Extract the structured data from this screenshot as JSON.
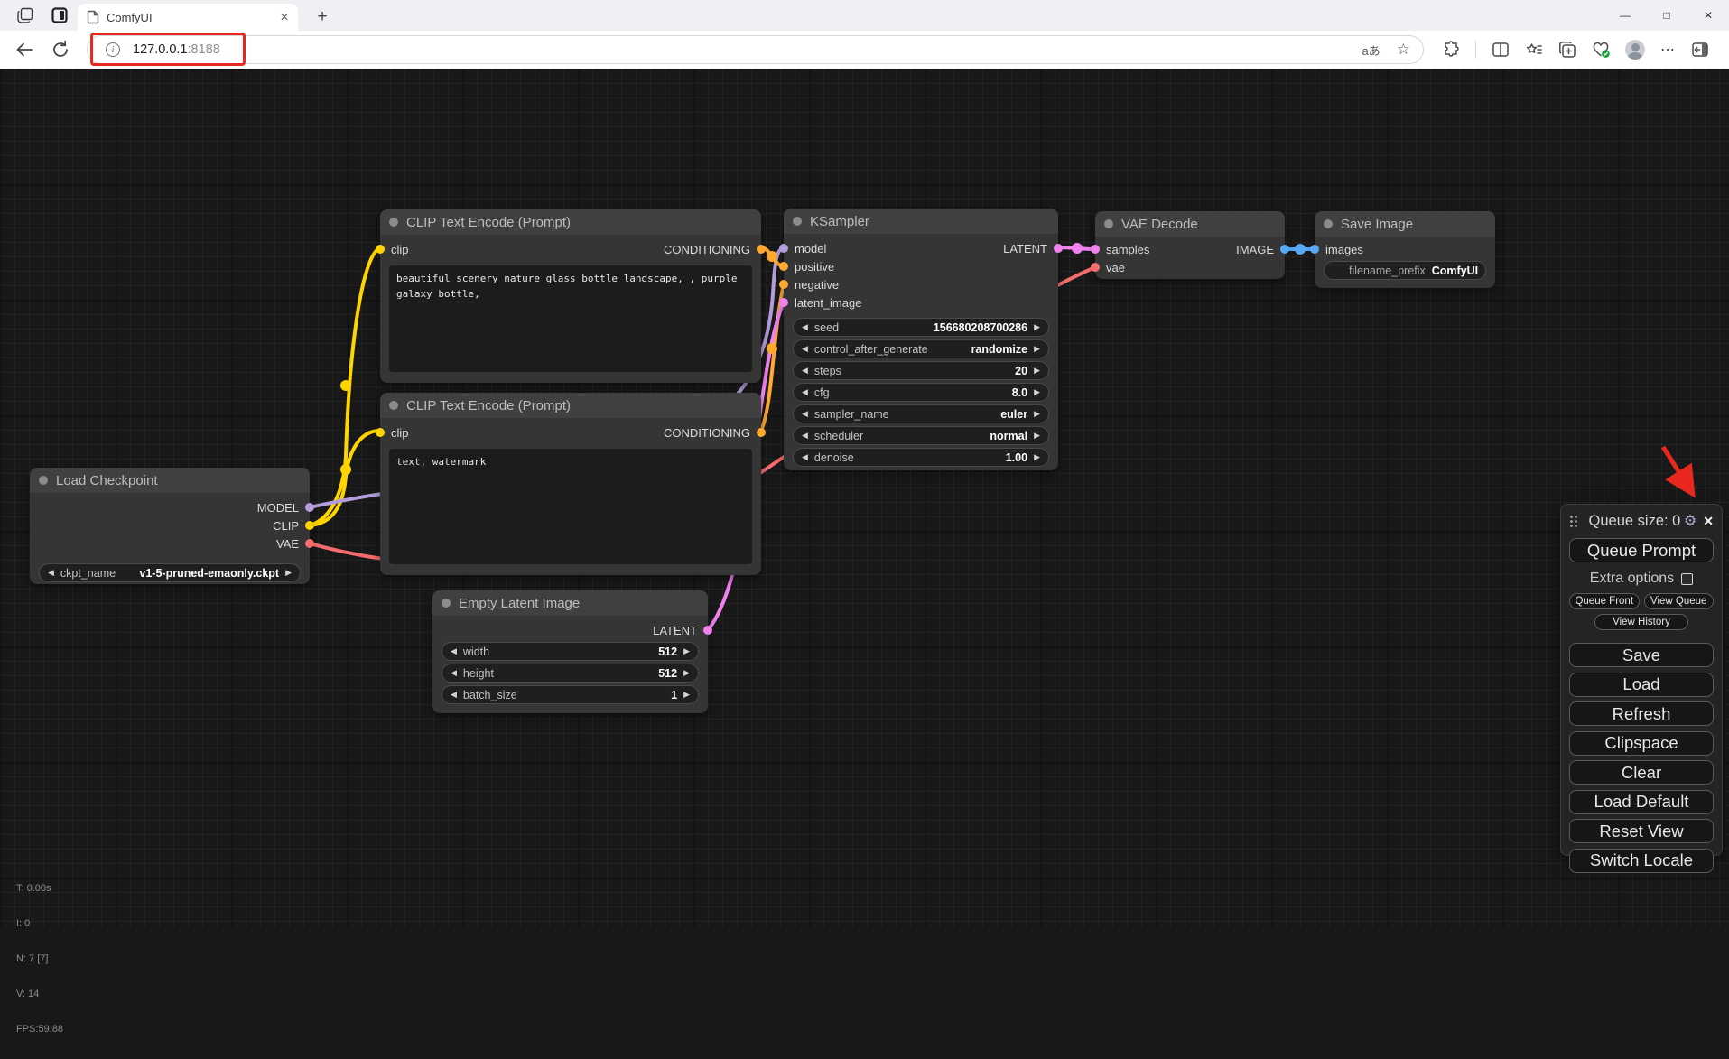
{
  "browser": {
    "tab_title": "ComfyUI",
    "url_host": "127.0.0.1",
    "url_port": ":8188",
    "translate_glyph": "aあ",
    "star_glyph": "☆",
    "info_glyph": "i",
    "close_glyph": "✕",
    "plus_glyph": "+",
    "minimize_glyph": "—",
    "maximize_glyph": "□",
    "more_glyph": "⋯"
  },
  "annotation_color": "#e8281e",
  "port_colors": {
    "MODEL": "#b39ddb",
    "CLIP": "#ffd500",
    "VAE": "#f56c6c",
    "CONDITIONING": "#ffa931",
    "LATENT": "#f183f1",
    "IMAGE": "#58a8f5"
  },
  "nodes": {
    "load_checkpoint": {
      "title": "Load Checkpoint",
      "outputs": {
        "model": "MODEL",
        "clip": "CLIP",
        "vae": "VAE"
      },
      "widgets": [
        {
          "label": "ckpt_name",
          "value": "v1-5-pruned-emaonly.ckpt"
        }
      ]
    },
    "clip_positive": {
      "title": "CLIP Text Encode (Prompt)",
      "inputs": {
        "clip": "clip"
      },
      "outputs": {
        "conditioning": "CONDITIONING"
      },
      "text": "beautiful scenery nature glass bottle landscape, , purple galaxy bottle,"
    },
    "clip_negative": {
      "title": "CLIP Text Encode (Prompt)",
      "inputs": {
        "clip": "clip"
      },
      "outputs": {
        "conditioning": "CONDITIONING"
      },
      "text": "text, watermark"
    },
    "empty_latent": {
      "title": "Empty Latent Image",
      "outputs": {
        "latent": "LATENT"
      },
      "widgets": [
        {
          "label": "width",
          "value": "512"
        },
        {
          "label": "height",
          "value": "512"
        },
        {
          "label": "batch_size",
          "value": "1"
        }
      ]
    },
    "ksampler": {
      "title": "KSampler",
      "inputs": {
        "model": "model",
        "positive": "positive",
        "negative": "negative",
        "latent_image": "latent_image"
      },
      "outputs": {
        "latent": "LATENT"
      },
      "widgets": [
        {
          "label": "seed",
          "value": "156680208700286"
        },
        {
          "label": "control_after_generate",
          "value": "randomize"
        },
        {
          "label": "steps",
          "value": "20"
        },
        {
          "label": "cfg",
          "value": "8.0"
        },
        {
          "label": "sampler_name",
          "value": "euler"
        },
        {
          "label": "scheduler",
          "value": "normal"
        },
        {
          "label": "denoise",
          "value": "1.00"
        }
      ]
    },
    "vae_decode": {
      "title": "VAE Decode",
      "inputs": {
        "samples": "samples",
        "vae": "vae"
      },
      "outputs": {
        "image": "IMAGE"
      }
    },
    "save_image": {
      "title": "Save Image",
      "inputs": {
        "images": "images"
      },
      "widgets": [
        {
          "label": "filename_prefix",
          "value": "ComfyUI"
        }
      ]
    }
  },
  "menu": {
    "queue_size": "Queue size: 0",
    "gear_glyph": "⚙",
    "close_glyph": "✕",
    "queue_prompt": "Queue Prompt",
    "extra_options": "Extra options",
    "queue_front": "Queue Front",
    "view_queue": "View Queue",
    "view_history": "View History",
    "buttons": [
      "Save",
      "Load",
      "Refresh",
      "Clipspace",
      "Clear",
      "Load Default",
      "Reset View",
      "Switch Locale"
    ]
  },
  "stats": {
    "lines": [
      "T: 0.00s",
      "I: 0",
      "N: 7 [7]",
      "V: 14",
      "FPS:59.88"
    ]
  },
  "widget_arrows": {
    "left": "◀",
    "right": "▶"
  }
}
